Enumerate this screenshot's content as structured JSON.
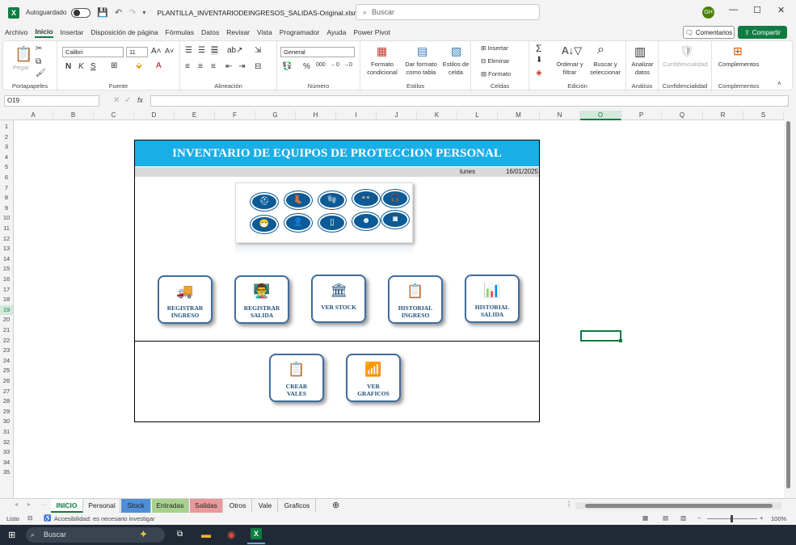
{
  "titlebar": {
    "app_icon": "excel-icon",
    "autosave_label": "Autoguardado",
    "autosave_state": "off",
    "filename": "PLANTILLA_INVENTARIODEINGRESOS_SALIDAS-Original.xlsm - E...",
    "search_placeholder": "Buscar",
    "user_initials": "GH",
    "minimize": "—",
    "maximize": "☐",
    "close": "✕"
  },
  "menu": {
    "items": [
      "Archivo",
      "Inicio",
      "Insertar",
      "Disposición de página",
      "Fórmulas",
      "Datos",
      "Revisar",
      "Vista",
      "Programador",
      "Ayuda",
      "Power Pivot"
    ],
    "active": "Inicio",
    "comments": "Comentarios",
    "share": "Compartir"
  },
  "ribbon": {
    "groups": [
      "Portapapeles",
      "Fuente",
      "Alineación",
      "Número",
      "Estilos",
      "Celdas",
      "Edición",
      "Análisis",
      "Confidencialidad",
      "Complementos"
    ],
    "paste": "Pegar",
    "font_name": "Calibri",
    "font_size": "11",
    "number_format": "General",
    "cond_format": "Formato\ncondicional",
    "table_format": "Dar formato\ncomo tabla",
    "cell_styles": "Estilos de\ncelda",
    "insert": "Insertar",
    "delete": "Eliminar",
    "format": "Formato",
    "sort_filter": "Ordenar y\nfiltrar",
    "find_select": "Buscar y\nseleccionar",
    "analyze": "Analizar\ndatos",
    "confidentiality": "Confidencialidad",
    "addins": "Complementos"
  },
  "formula_bar": {
    "name_box": "O19",
    "fx": "fx",
    "formula": ""
  },
  "grid": {
    "columns": [
      "A",
      "B",
      "C",
      "D",
      "E",
      "F",
      "G",
      "H",
      "I",
      "J",
      "K",
      "L",
      "M",
      "N",
      "O",
      "P",
      "Q",
      "R",
      "S"
    ],
    "selected_column": "O",
    "rows": [
      "1",
      "2",
      "3",
      "4",
      "5",
      "6",
      "7",
      "8",
      "9",
      "10",
      "11",
      "12",
      "13",
      "14",
      "15",
      "16",
      "17",
      "18",
      "19",
      "20",
      "21",
      "22",
      "23",
      "24",
      "25",
      "26",
      "27",
      "28",
      "29",
      "30",
      "31",
      "32",
      "33",
      "34",
      "35"
    ],
    "selected_row": "19"
  },
  "dashboard": {
    "title": "INVENTARIO DE EQUIPOS DE PROTECCION PERSONAL",
    "day": "lunes",
    "date": "16/01/2025",
    "banner_color": "#1aaee7",
    "ppe_icons": [
      "hard-hat",
      "boots",
      "gloves",
      "goggles",
      "ear-protection",
      "respirator",
      "coverall",
      "apron",
      "face-shield",
      "welding-mask"
    ],
    "buttons_row1": [
      {
        "label": "REGISTRAR\nINGRESO",
        "icon": "truck-icon",
        "glyph": "🚚"
      },
      {
        "label": "REGISTRAR\nSALIDA",
        "icon": "presenter-icon",
        "glyph": "👨‍🏫"
      },
      {
        "label": "VER STOCK",
        "icon": "bank-icon",
        "glyph": "🏛"
      },
      {
        "label": "HISTORIAL\nINGRESO",
        "icon": "list-icon",
        "glyph": "📋"
      },
      {
        "label": "HISTORIAL\nSALIDA",
        "icon": "chart-board-icon",
        "glyph": "📊"
      }
    ],
    "buttons_row2": [
      {
        "label": "CREAR\nVALES",
        "icon": "clipboard-icon",
        "glyph": "📋"
      },
      {
        "label": "VER\nGRAFICOS",
        "icon": "bar-chart-icon",
        "glyph": "📶"
      }
    ]
  },
  "sheets": {
    "tabs": [
      {
        "name": "INICIO",
        "color": "#ffffff"
      },
      {
        "name": "Personal",
        "color": "#f3f3f3"
      },
      {
        "name": "Stock",
        "color": "#4f8fd6"
      },
      {
        "name": "Entradas",
        "color": "#a9d18e"
      },
      {
        "name": "Salidas",
        "color": "#e89a9a"
      },
      {
        "name": "Otros",
        "color": "#f3f3f3"
      },
      {
        "name": "Vale",
        "color": "#f3f3f3"
      },
      {
        "name": "Graficos",
        "color": "#f3f3f3"
      }
    ],
    "active": "INICIO"
  },
  "status": {
    "ready": "Listo",
    "accessibility": "Accesibilidad: es necesario investigar",
    "zoom": "100%"
  },
  "taskbar": {
    "search": "Buscar"
  }
}
